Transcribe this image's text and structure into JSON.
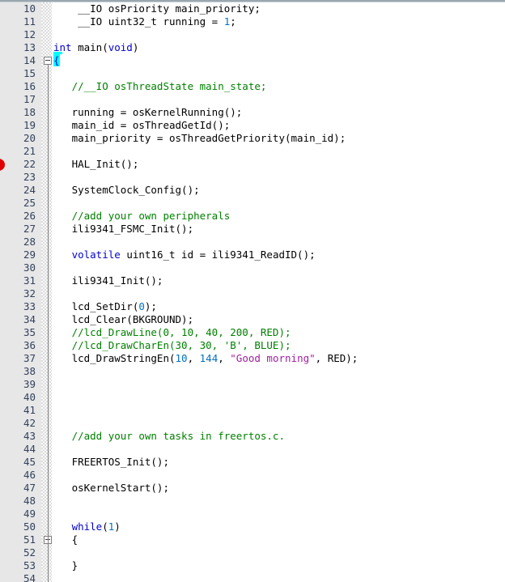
{
  "editor": {
    "title": "main.c source editor",
    "language": "C",
    "first_visible_line": 10,
    "last_visible_line": 54,
    "line_height": 16,
    "colors": {
      "background": "#ffffff",
      "gutter_background": "#e7e7e7",
      "fold_column_background": "#fafafa",
      "line_number": "#33415c",
      "keyword": "#0000d0",
      "number": "#0070c0",
      "comment": "#008000",
      "string": "#a020a0",
      "plain_text": "#000000",
      "bracket_match_highlight": "#00ffff",
      "breakpoint": "#e00000",
      "fold_guide": "#808080",
      "top_border": "#9aa7ae"
    }
  },
  "markers": {
    "breakpoint_lines": [
      22
    ],
    "fold_boxes": [
      14,
      51
    ],
    "bracket_match_line": 14,
    "caret_line": 13
  },
  "lines": [
    {
      "n": 10,
      "tokens": [
        {
          "t": "    __IO osPriority main_priority;",
          "c": "plain"
        }
      ]
    },
    {
      "n": 11,
      "tokens": [
        {
          "t": "    __IO uint32_t running = ",
          "c": "plain"
        },
        {
          "t": "1",
          "c": "num"
        },
        {
          "t": ";",
          "c": "plain"
        }
      ]
    },
    {
      "n": 12,
      "tokens": []
    },
    {
      "n": 13,
      "tokens": [
        {
          "t": "int",
          "c": "kw"
        },
        {
          "t": " main(",
          "c": "plain"
        },
        {
          "t": "void",
          "c": "kw"
        },
        {
          "t": ")",
          "c": "plain"
        }
      ]
    },
    {
      "n": 14,
      "tokens": [
        {
          "t": "{",
          "c": "sel"
        }
      ]
    },
    {
      "n": 15,
      "tokens": []
    },
    {
      "n": 16,
      "tokens": [
        {
          "t": "   //__IO osThreadState main_state;",
          "c": "cmt"
        }
      ]
    },
    {
      "n": 17,
      "tokens": []
    },
    {
      "n": 18,
      "tokens": [
        {
          "t": "   running = osKernelRunning();",
          "c": "plain"
        }
      ]
    },
    {
      "n": 19,
      "tokens": [
        {
          "t": "   main_id = osThreadGetId();",
          "c": "plain"
        }
      ]
    },
    {
      "n": 20,
      "tokens": [
        {
          "t": "   main_priority = osThreadGetPriority(main_id);",
          "c": "plain"
        }
      ]
    },
    {
      "n": 21,
      "tokens": []
    },
    {
      "n": 22,
      "tokens": [
        {
          "t": "   HAL_Init();",
          "c": "plain"
        }
      ]
    },
    {
      "n": 23,
      "tokens": []
    },
    {
      "n": 24,
      "tokens": [
        {
          "t": "   SystemClock_Config();",
          "c": "plain"
        }
      ]
    },
    {
      "n": 25,
      "tokens": []
    },
    {
      "n": 26,
      "tokens": [
        {
          "t": "   //add your own peripherals",
          "c": "cmt"
        }
      ]
    },
    {
      "n": 27,
      "tokens": [
        {
          "t": "   ili9341_FSMC_Init();",
          "c": "plain"
        }
      ]
    },
    {
      "n": 28,
      "tokens": []
    },
    {
      "n": 29,
      "tokens": [
        {
          "t": "   ",
          "c": "plain"
        },
        {
          "t": "volatile",
          "c": "kw"
        },
        {
          "t": " uint16_t id = ili9341_ReadID();",
          "c": "plain"
        }
      ]
    },
    {
      "n": 30,
      "tokens": []
    },
    {
      "n": 31,
      "tokens": [
        {
          "t": "   ili9341_Init();",
          "c": "plain"
        }
      ]
    },
    {
      "n": 32,
      "tokens": []
    },
    {
      "n": 33,
      "tokens": [
        {
          "t": "   lcd_SetDir(",
          "c": "plain"
        },
        {
          "t": "0",
          "c": "num"
        },
        {
          "t": ");",
          "c": "plain"
        }
      ]
    },
    {
      "n": 34,
      "tokens": [
        {
          "t": "   lcd_Clear(BKGROUND);",
          "c": "plain"
        }
      ]
    },
    {
      "n": 35,
      "tokens": [
        {
          "t": "   //lcd_DrawLine(0, 10, 40, 200, RED);",
          "c": "cmt"
        }
      ]
    },
    {
      "n": 36,
      "tokens": [
        {
          "t": "   //lcd_DrawCharEn(30, 30, 'B', BLUE);",
          "c": "cmt"
        }
      ]
    },
    {
      "n": 37,
      "tokens": [
        {
          "t": "   lcd_DrawStringEn(",
          "c": "plain"
        },
        {
          "t": "10",
          "c": "num"
        },
        {
          "t": ", ",
          "c": "plain"
        },
        {
          "t": "144",
          "c": "num"
        },
        {
          "t": ", ",
          "c": "plain"
        },
        {
          "t": "\"Good morning\"",
          "c": "str"
        },
        {
          "t": ", RED);",
          "c": "plain"
        }
      ]
    },
    {
      "n": 38,
      "tokens": []
    },
    {
      "n": 39,
      "tokens": []
    },
    {
      "n": 40,
      "tokens": []
    },
    {
      "n": 41,
      "tokens": []
    },
    {
      "n": 42,
      "tokens": []
    },
    {
      "n": 43,
      "tokens": [
        {
          "t": "   //add your own tasks in freertos.c.",
          "c": "cmt"
        }
      ]
    },
    {
      "n": 44,
      "tokens": []
    },
    {
      "n": 45,
      "tokens": [
        {
          "t": "   FREERTOS_Init();",
          "c": "plain"
        }
      ]
    },
    {
      "n": 46,
      "tokens": []
    },
    {
      "n": 47,
      "tokens": [
        {
          "t": "   osKernelStart();",
          "c": "plain"
        }
      ]
    },
    {
      "n": 48,
      "tokens": []
    },
    {
      "n": 49,
      "tokens": []
    },
    {
      "n": 50,
      "tokens": [
        {
          "t": "   ",
          "c": "plain"
        },
        {
          "t": "while",
          "c": "kw"
        },
        {
          "t": "(",
          "c": "plain"
        },
        {
          "t": "1",
          "c": "num"
        },
        {
          "t": ")",
          "c": "plain"
        }
      ]
    },
    {
      "n": 51,
      "tokens": [
        {
          "t": "   {",
          "c": "plain"
        }
      ]
    },
    {
      "n": 52,
      "tokens": []
    },
    {
      "n": 53,
      "tokens": [
        {
          "t": "   }",
          "c": "plain"
        }
      ]
    },
    {
      "n": 54,
      "tokens": []
    }
  ]
}
